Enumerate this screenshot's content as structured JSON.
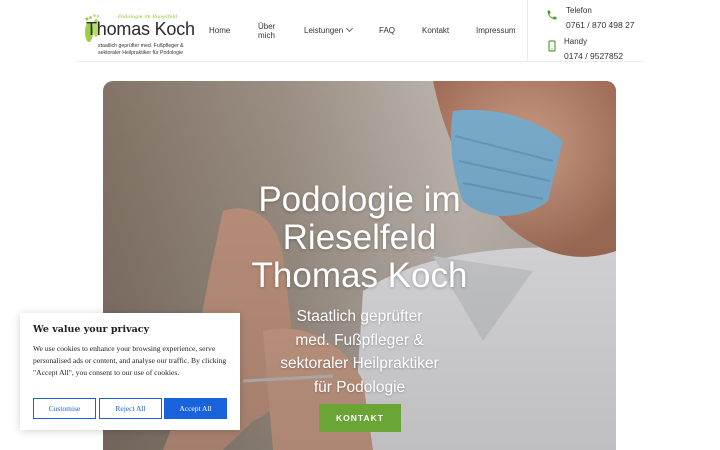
{
  "logo": {
    "tagline": "Podologie im Rieselfeld",
    "name": "Thomas Koch",
    "subline_1": "staatlich geprüfter med. Fußpfleger &",
    "subline_2": "sektoraler Heilpraktiker für Podologie"
  },
  "nav": {
    "home": "Home",
    "ueber": "Über mich",
    "leistungen": "Leistungen",
    "faq": "FAQ",
    "kontakt": "Kontakt",
    "impressum": "Impressum"
  },
  "contact": {
    "telefon_label": "Telefon",
    "telefon_value": "0761 / 870 498 27",
    "handy_label": "Handy",
    "handy_value": "0174 / 9527852"
  },
  "hero": {
    "title_line_1": "Podologie im",
    "title_line_2": "Rieselfeld",
    "title_line_3": "Thomas Koch",
    "sub_line_1": "Staatlich geprüfter",
    "sub_line_2": "med. Fußpfleger &",
    "sub_line_3": "sektoraler Heilpraktiker",
    "sub_line_4": "für Podologie",
    "button": "KONTAKT"
  },
  "cookie": {
    "title": "We value your privacy",
    "text": "We use cookies to enhance your browsing experience, serve personalised ads or content, and analyse our traffic. By clicking \"Accept All\", you consent to our use of cookies.",
    "customise": "Customise",
    "reject": "Reject All",
    "accept": "Accept All"
  },
  "colors": {
    "accent_green": "#6aa535",
    "cookie_blue": "#1863dc"
  },
  "icons": {
    "phone": "phone-icon",
    "mobile": "mobile-phone-icon",
    "chevron": "chevron-down-icon",
    "logo_feet": "feet-logo-icon"
  }
}
